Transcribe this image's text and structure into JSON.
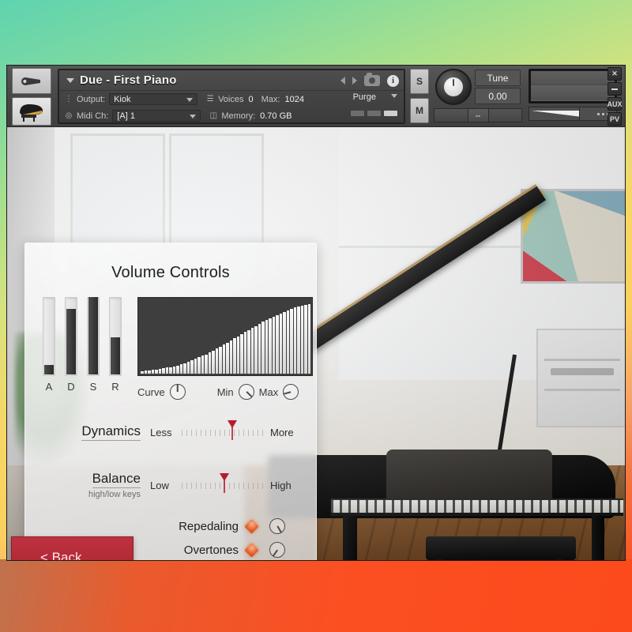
{
  "window": {
    "title": "Due - First Piano",
    "edge_buttons": [
      {
        "name": "close",
        "label": "✕"
      },
      {
        "name": "minimize",
        "label": ""
      },
      {
        "name": "aux",
        "label": "AUX"
      },
      {
        "name": "pv",
        "label": "PV"
      }
    ]
  },
  "header": {
    "instrument_name": "Due - First Piano",
    "output": {
      "label": "Output:",
      "value": "Kiok"
    },
    "midi_ch": {
      "label": "Midi Ch:",
      "value": "[A]  1"
    },
    "voices": {
      "label": "Voices",
      "value": "0"
    },
    "max": {
      "label": "Max:",
      "value": "1024"
    },
    "memory": {
      "label": "Memory:",
      "value": "0.70 GB"
    },
    "purge": {
      "label": "Purge"
    },
    "solo_button": "S",
    "mute_button": "M",
    "tune": {
      "label": "Tune",
      "value": "0.00"
    },
    "icons": {
      "wrench": "wrench-icon",
      "instrument": "piano-icon",
      "prev": "prev-arrow-icon",
      "next": "next-arrow-icon",
      "snapshot": "camera-icon",
      "info": "i"
    }
  },
  "panel": {
    "title": "Volume Controls",
    "adsr": {
      "labels": [
        "A",
        "D",
        "S",
        "R"
      ],
      "values": [
        12,
        85,
        100,
        48
      ]
    },
    "curve_display": {
      "bars": 48,
      "heights": [
        3,
        4,
        4,
        5,
        5,
        6,
        7,
        8,
        9,
        10,
        11,
        13,
        14,
        16,
        18,
        20,
        22,
        24,
        26,
        29,
        31,
        34,
        36,
        39,
        42,
        45,
        48,
        50,
        53,
        56,
        59,
        62,
        64,
        67,
        70,
        72,
        74,
        77,
        79,
        81,
        83,
        85,
        87,
        89,
        90,
        92,
        93,
        94
      ]
    },
    "knobs": [
      {
        "name": "curve",
        "label": "Curve",
        "angle": 0
      },
      {
        "name": "min",
        "label": "Min",
        "angle": 135
      },
      {
        "name": "max",
        "label": "Max",
        "angle": 255
      }
    ],
    "dynamics": {
      "name": "Dynamics",
      "min_label": "Less",
      "max_label": "More",
      "value": 62
    },
    "balance": {
      "name": "Balance",
      "sublabel": "high/low keys",
      "min_label": "Low",
      "max_label": "High",
      "value": 52
    },
    "toggles": [
      {
        "name": "repedaling",
        "label": "Repedaling",
        "led_on": true,
        "angle": 150
      },
      {
        "name": "overtones",
        "label": "Overtones",
        "led_on": true,
        "angle": 215
      }
    ],
    "back_button": "< Back"
  }
}
